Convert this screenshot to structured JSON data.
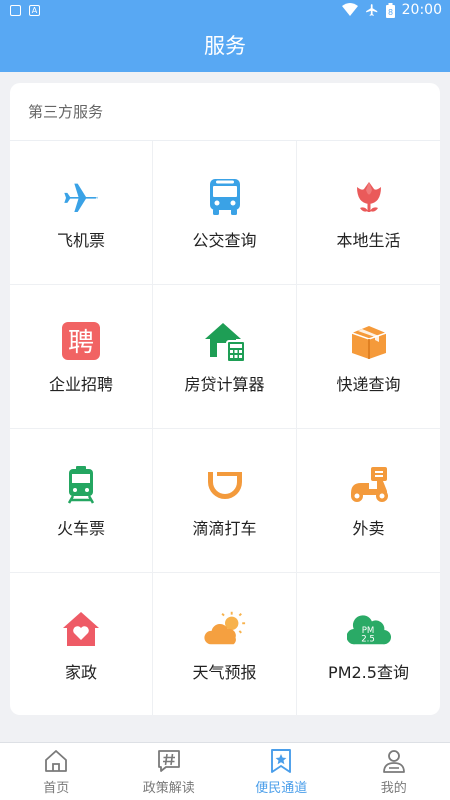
{
  "status_bar": {
    "time": "20:00"
  },
  "header": {
    "title": "服务"
  },
  "section": {
    "title": "第三方服务"
  },
  "services": [
    {
      "label": "飞机票",
      "icon": "airplane-icon",
      "color": "#3aa2e6"
    },
    {
      "label": "公交查询",
      "icon": "bus-icon",
      "color": "#3aa2e6"
    },
    {
      "label": "本地生活",
      "icon": "tulip-icon",
      "color": "#ea5a5a"
    },
    {
      "label": "企业招聘",
      "icon": "recruit-icon",
      "color": "#f16363"
    },
    {
      "label": "房贷计算器",
      "icon": "house-calculator-icon",
      "color": "#1e9e55"
    },
    {
      "label": "快递查询",
      "icon": "package-icon",
      "color": "#f59a3a"
    },
    {
      "label": "火车票",
      "icon": "train-icon",
      "color": "#24a661"
    },
    {
      "label": "滴滴打车",
      "icon": "didi-icon",
      "color": "#f39a3c"
    },
    {
      "label": "外卖",
      "icon": "scooter-icon",
      "color": "#f39a3c"
    },
    {
      "label": "家政",
      "icon": "home-heart-icon",
      "color": "#ee5b66"
    },
    {
      "label": "天气预报",
      "icon": "sun-cloud-icon",
      "color": "#f5a040"
    },
    {
      "label": "PM2.5查询",
      "icon": "pm25-cloud-icon",
      "color": "#2aaa66"
    }
  ],
  "tabs": [
    {
      "label": "首页",
      "icon": "home-icon",
      "active": false
    },
    {
      "label": "政策解读",
      "icon": "hashtag-icon",
      "active": false
    },
    {
      "label": "便民通道",
      "icon": "bookmark-star-icon",
      "active": true
    },
    {
      "label": "我的",
      "icon": "user-icon",
      "active": false
    }
  ],
  "colors": {
    "primary": "#58a8f3",
    "tab_active": "#4a9eea",
    "tab_inactive": "#7a7a7a"
  }
}
